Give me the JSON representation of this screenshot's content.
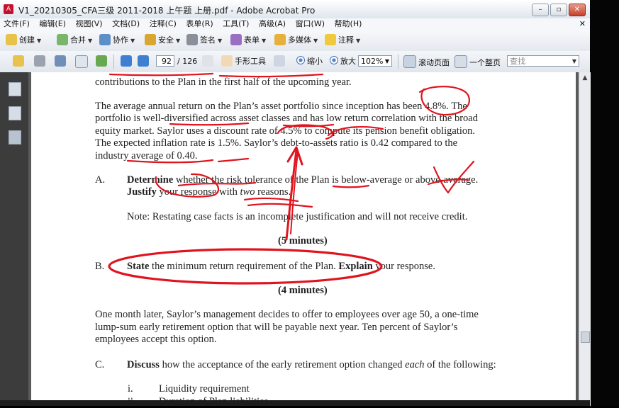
{
  "window": {
    "title": "V1_20210305_CFA三级 2011-2018 上午题  上册.pdf - Adobe Acrobat Pro"
  },
  "menu": [
    "文件(F)",
    "编辑(E)",
    "视图(V)",
    "文档(D)",
    "注释(C)",
    "表单(R)",
    "工具(T)",
    "高级(A)",
    "窗口(W)",
    "帮助(H)"
  ],
  "toolbar1": {
    "create": "创建",
    "combine": "合并",
    "collaborate": "协作",
    "secure": "安全",
    "sign": "签名",
    "forms": "表单",
    "multimedia": "多媒体",
    "comment": "注释"
  },
  "toolbar2": {
    "page_current": "92",
    "page_total": "/ 126",
    "hand_tool": "手形工具",
    "zoom_out": "缩小",
    "zoom_in": "放大",
    "zoom_level": "102%",
    "scroll_page": "滚动页面",
    "single_page": "一个整页",
    "search_placeholder": "查找"
  },
  "document": {
    "p0": "contributions to the Plan in the first half of the upcoming year.",
    "p1": [
      "The average annual return on the Plan’s asset portfolio since inception has been 4.8%.  The",
      "portfolio is well-diversified across asset classes and has low return correlation with the broad",
      "equity market.  Saylor uses a discount rate of 4.5% to compute its pension benefit obligation.",
      "The expected inflation rate is 1.5%.  Saylor’s debt-to-assets ratio is 0.42 compared to the",
      "industry average of 0.40."
    ],
    "qA_label": "A.",
    "qA_bold1": "Determine",
    "qA_text1": " whether the risk tolerance of the Plan is below-average or above-average.",
    "qA_bold2": "Justify",
    "qA_text2a": " your response with ",
    "qA_italic": "two",
    "qA_text2b": " reasons.",
    "note": "Note:  Restating case facts is an incomplete justification and will not receive credit.",
    "time5": "(5 minutes)",
    "qB_label": "B.",
    "qB_bold1": "State",
    "qB_text1": " the minimum return requirement of the Plan.  ",
    "qB_bold2": "Explain",
    "qB_text2": " your response.",
    "time4": "(4 minutes)",
    "p2": [
      "One month later, Saylor’s management decides to offer to employees over age 50, a one-time",
      "lump-sum early retirement option that will be payable next year.  Ten percent of Saylor’s",
      "employees accept this option."
    ],
    "qC_label": "C.",
    "qC_bold": "Discuss",
    "qC_text1": " how the acceptance of the early retirement option changed ",
    "qC_italic": "each",
    "qC_text2": " of the following:",
    "i_label": "i.",
    "i_text": "Liquidity requirement",
    "ii_label": "ii.",
    "ii_text": "Duration of Plan liabilities"
  },
  "colors": {
    "annotation_red": "#e0141e",
    "accent": "#4f86d6"
  }
}
